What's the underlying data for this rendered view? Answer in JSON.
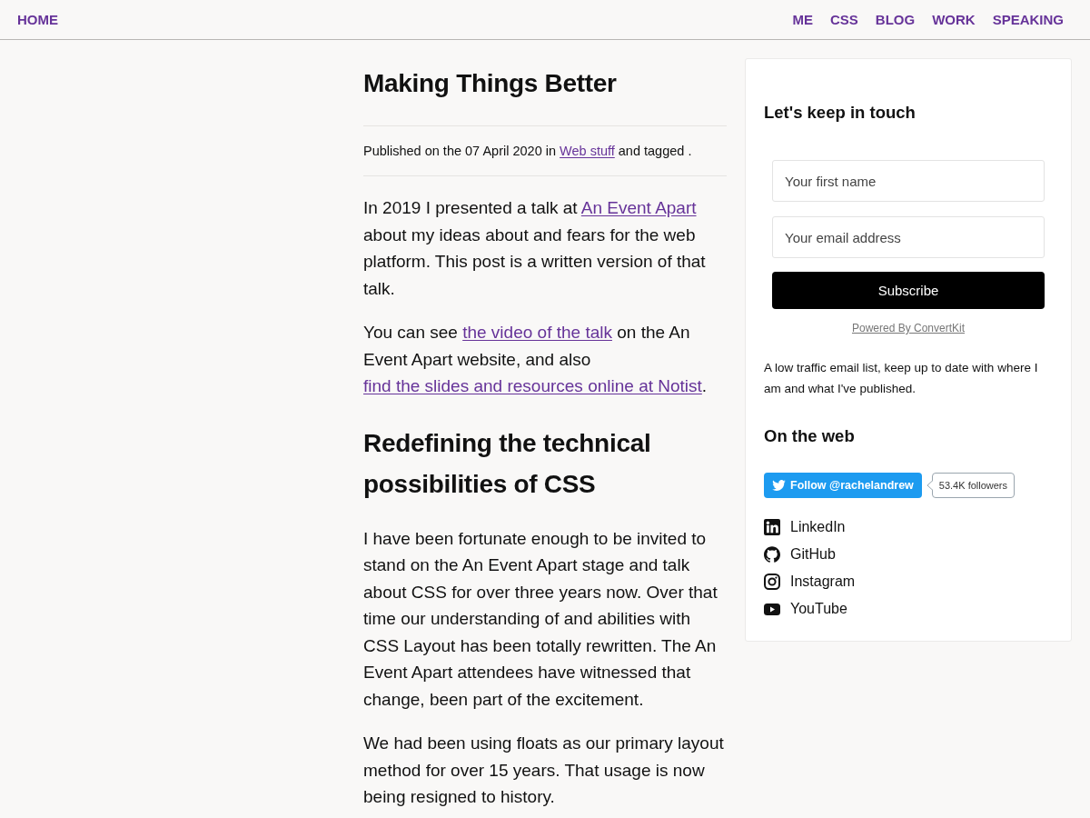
{
  "nav": {
    "home": "HOME",
    "links": [
      "ME",
      "CSS",
      "BLOG",
      "WORK",
      "SPEAKING"
    ]
  },
  "article": {
    "title": "Making Things Better",
    "meta": [
      {
        "kind": "text",
        "text": "Published on the 07 April 2020 in "
      },
      {
        "kind": "link",
        "text": "Web stuff"
      },
      {
        "kind": "text",
        "text": " and tagged ."
      }
    ],
    "blocks": [
      {
        "kind": "paragraph",
        "parts": [
          {
            "kind": "text",
            "text": "In 2019 I presented a talk at "
          },
          {
            "kind": "link",
            "text": "An Event Apart"
          },
          {
            "kind": "text",
            "text": " about my ideas about and fears for the web platform. This post is a written version of that talk."
          }
        ]
      },
      {
        "kind": "paragraph",
        "parts": [
          {
            "kind": "text",
            "text": "You can see "
          },
          {
            "kind": "link",
            "text": "the video of the talk"
          },
          {
            "kind": "text",
            "text": " on the An Event Apart website, and also "
          },
          {
            "kind": "link",
            "text": "find the slides and resources online at Notist"
          },
          {
            "kind": "text",
            "text": "."
          }
        ]
      },
      {
        "kind": "heading",
        "text": "Redefining the technical possibilities of CSS"
      },
      {
        "kind": "paragraph",
        "parts": [
          {
            "kind": "text",
            "text": "I have been fortunate enough to be invited to stand on the An Event Apart stage and talk about CSS for over three years now. Over that time our understanding of and abilities with CSS Layout has been totally rewritten. The An Event Apart attendees have witnessed that change, been part of the excitement."
          }
        ]
      },
      {
        "kind": "paragraph",
        "parts": [
          {
            "kind": "text",
            "text": "We had been using floats as our primary layout method for over 15 years. That usage is now being resigned to history."
          }
        ]
      }
    ]
  },
  "sidebar": {
    "signup": {
      "title": "Let's keep in touch",
      "fields": [
        {
          "placeholder": "Your first name"
        },
        {
          "placeholder": "Your email address"
        }
      ],
      "button": "Subscribe",
      "powered_by": "Powered By ConvertKit",
      "description": "A low traffic email list, keep up to date with where I am and what I've published."
    },
    "social": {
      "title": "On the web",
      "follow_button": "Follow @rachelandrew",
      "follower_count": "53.4K followers",
      "links": [
        {
          "kind": "linkedin",
          "label": "LinkedIn"
        },
        {
          "kind": "github",
          "label": "GitHub"
        },
        {
          "kind": "instagram",
          "label": "Instagram"
        },
        {
          "kind": "youtube",
          "label": "YouTube"
        }
      ]
    }
  }
}
